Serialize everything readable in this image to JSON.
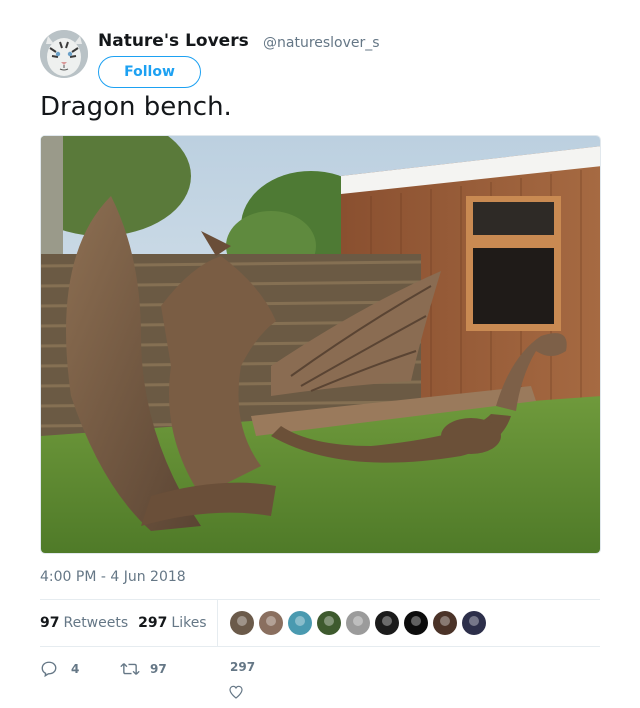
{
  "author": {
    "display_name": "Nature's Lovers",
    "handle": "@natureslover_s",
    "avatar_icon": "white-tiger-avatar"
  },
  "follow_button": {
    "label": "Follow"
  },
  "tweet": {
    "text": "Dragon bench.",
    "media_icon": "dragon-bench-photo",
    "timestamp": "4:00 PM - 4 Jun 2018"
  },
  "stats": {
    "retweets_count": "97",
    "retweets_label": "Retweets",
    "likes_count": "297",
    "likes_label": "Likes"
  },
  "likers": [
    {
      "icon": "liker-avatar-1",
      "color": "#6b5a4a"
    },
    {
      "icon": "liker-avatar-2",
      "color": "#8a6f5f"
    },
    {
      "icon": "liker-avatar-3",
      "color": "#4a9ab0"
    },
    {
      "icon": "liker-avatar-4",
      "color": "#3e5a2e"
    },
    {
      "icon": "liker-avatar-5",
      "color": "#9b9b9b"
    },
    {
      "icon": "liker-avatar-6",
      "color": "#1b1b1b"
    },
    {
      "icon": "liker-avatar-7",
      "color": "#0c0c0c"
    },
    {
      "icon": "liker-avatar-8",
      "color": "#4b3328"
    },
    {
      "icon": "liker-avatar-9",
      "color": "#2d2f4a"
    }
  ],
  "actions": {
    "reply_count": "4",
    "retweet_count": "97",
    "like_count": "297"
  },
  "colors": {
    "accent": "#1da1f2",
    "text_secondary": "#657786",
    "divider": "#e6ecf0"
  }
}
